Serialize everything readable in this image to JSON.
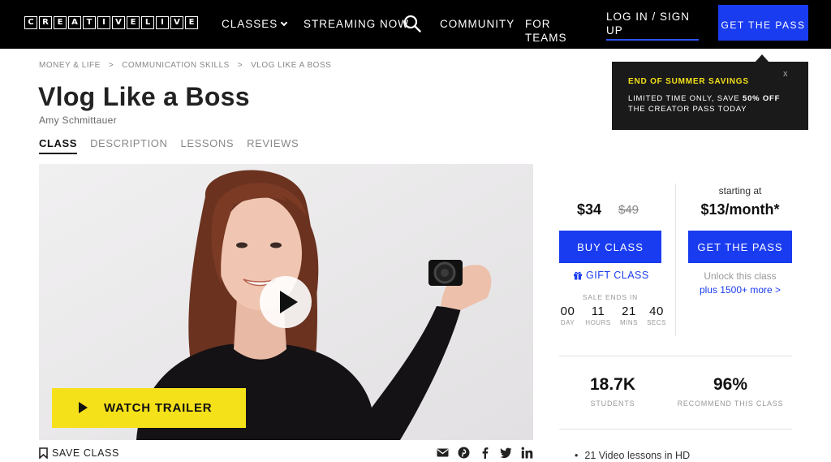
{
  "nav": {
    "logo_letters": [
      "C",
      "R",
      "E",
      "A",
      "T",
      "I",
      "V",
      "E",
      "L",
      "I",
      "V",
      "E"
    ],
    "classes": "CLASSES",
    "streaming": "STREAMING NOW",
    "community": "COMMUNITY",
    "teams": "FOR TEAMS",
    "login": "LOG IN / SIGN UP",
    "get_pass": "GET THE PASS"
  },
  "promo": {
    "title": "END OF SUMMER SAVINGS",
    "text_before": "LIMITED TIME ONLY, SAVE ",
    "text_bold": "50% OFF",
    "text_after": " THE CREATOR PASS TODAY",
    "close": "x"
  },
  "breadcrumb": [
    "MONEY & LIFE",
    ">",
    "COMMUNICATION SKILLS",
    ">",
    "VLOG LIKE A BOSS"
  ],
  "course": {
    "title": "Vlog Like a Boss",
    "author": "Amy Schmittauer"
  },
  "tabs": [
    "CLASS",
    "DESCRIPTION",
    "LESSONS",
    "REVIEWS"
  ],
  "video": {
    "trailer_label": "WATCH TRAILER"
  },
  "save_label": "SAVE CLASS",
  "buy": {
    "price": "$34",
    "old_price": "$49",
    "button": "BUY CLASS",
    "gift": "GIFT CLASS",
    "sale_ends": "SALE ENDS IN",
    "countdown": [
      {
        "num": "00",
        "unit": "DAY"
      },
      {
        "num": "11",
        "unit": "HOURS"
      },
      {
        "num": "21",
        "unit": "MINS"
      },
      {
        "num": "40",
        "unit": "SECS"
      }
    ]
  },
  "pass": {
    "starting": "starting at",
    "price": "$13/month*",
    "button": "GET THE PASS",
    "unlock": "Unlock this class",
    "more": "plus 1500+ more >"
  },
  "stats": [
    {
      "value": "18.7K",
      "label": "STUDENTS"
    },
    {
      "value": "96%",
      "label": "RECOMMEND THIS CLASS"
    }
  ],
  "features": [
    "21 Video lessons in HD"
  ],
  "colors": {
    "accent": "#1a3cf0",
    "yellow": "#f5e11a",
    "nav_bg": "#000000"
  }
}
